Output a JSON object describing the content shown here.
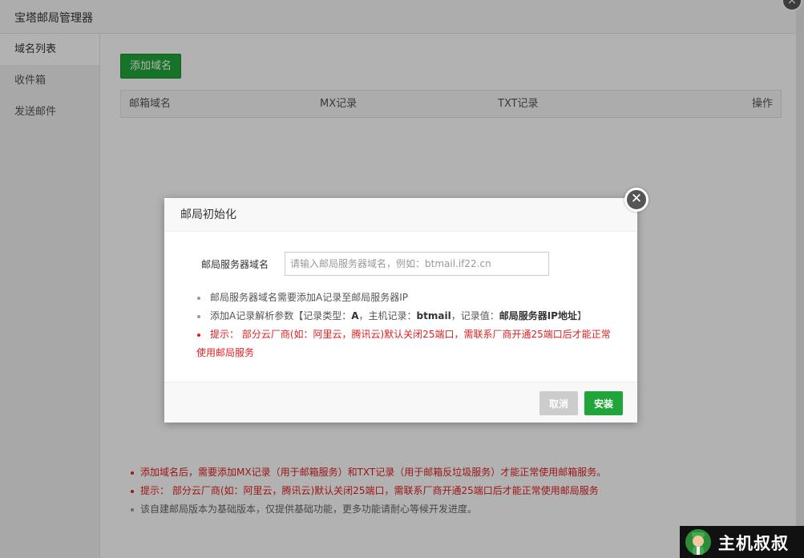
{
  "window": {
    "title": "宝塔邮局管理器",
    "close_glyph": "×"
  },
  "sidebar": {
    "items": [
      {
        "label": "域名列表",
        "active": true
      },
      {
        "label": "收件箱",
        "active": false
      },
      {
        "label": "发送邮件",
        "active": false
      }
    ]
  },
  "main": {
    "add_domain_label": "添加域名",
    "table": {
      "columns": [
        "邮箱域名",
        "MX记录",
        "TXT记录",
        "操作"
      ]
    },
    "notes": [
      {
        "text": "添加域名后，需要添加MX记录（用于邮箱服务）和TXT记录（用于邮箱反垃圾服务）才能正常使用邮箱服务。",
        "color": "red"
      },
      {
        "text": "提示： 部分云厂商(如：阿里云，腾讯云)默认关闭25端口，需联系厂商开通25端口后才能正常使用邮局服务",
        "color": "red"
      },
      {
        "text": "该自建邮局版本为基础版本，仅提供基础功能，更多功能请耐心等候开发进度。",
        "color": "gray"
      }
    ]
  },
  "modal": {
    "title": "邮局初始化",
    "close_glyph": "✕",
    "field_label": "邮局服务器域名",
    "field_placeholder": "请输入邮局服务器域名，例如：btmail.if22.cn",
    "field_value": "",
    "tips": {
      "tip1": "邮局服务器域名需要添加A记录至邮局服务器IP",
      "tip2_prefix": "添加A记录解析参数【记录类型：",
      "tip2_type": "A",
      "tip2_mid1": "，主机记录：",
      "tip2_host": "btmail",
      "tip2_mid2": "，记录值：",
      "tip2_value": "邮局服务器IP地址",
      "tip2_suffix": "】",
      "tip3": "提示： 部分云厂商(如：阿里云，腾讯云)默认关闭25端口，需联系厂商开通25端口后才能正常使用邮局服务"
    },
    "cancel_label": "取消",
    "install_label": "安装"
  },
  "watermark": {
    "text": "主机叔叔"
  },
  "colors": {
    "brand_green": "#20a53a",
    "warning_red": "#e02020",
    "cancel_gray": "#cccccc"
  }
}
